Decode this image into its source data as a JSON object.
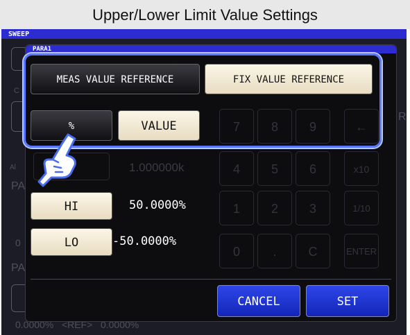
{
  "banner": {
    "title": "Upper/Lower Limit Value Settings"
  },
  "screen": {
    "label": "SWEEP"
  },
  "dialog": {
    "label": "PARA1"
  },
  "reference": {
    "meas_label": "MEAS VALUE REFERENCE",
    "fix_label": "FIX VALUE REFERENCE"
  },
  "mode": {
    "percent_label": "%",
    "value_label": "VALUE"
  },
  "limits": {
    "hi_label": "HI",
    "hi_value": "50.0000%",
    "lo_label": "LO",
    "lo_value": "-50.0000%"
  },
  "actions": {
    "cancel_label": "CANCEL",
    "set_label": "SET"
  },
  "background": {
    "ref_value": "1.000000k",
    "param_a": "PA",
    "param_b": "PA",
    "al_tag": "Al",
    "c_tag": "C",
    "r_tag": "R",
    "bottom_text": "0.0000%   <REF>   0.0000%",
    "edge_text": "0"
  },
  "keypad": {
    "keys": [
      "7",
      "8",
      "9",
      "←",
      "4",
      "5",
      "6",
      "x10",
      "1",
      "2",
      "3",
      "1/10",
      "0",
      ".",
      "C",
      "ENTER"
    ]
  }
}
